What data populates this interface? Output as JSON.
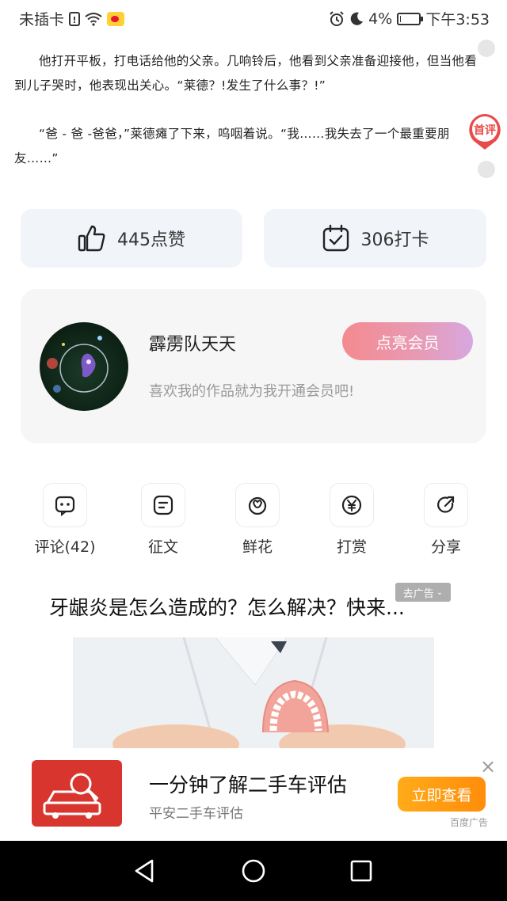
{
  "status_bar": {
    "carrier": "未插卡",
    "sim_glyph": "!",
    "battery": "4%",
    "battery_level": 0.04,
    "time": "下午3:53",
    "icons": [
      "sim-icon",
      "wifi-icon",
      "weibo-icon",
      "alarm-icon",
      "moon-icon",
      "battery-icon"
    ]
  },
  "article": {
    "paragraph1": "他打开平板，打电话给他的父亲。几响铃后，他看到父亲准备迎接他，但当他看到儿子哭时，他表现出关心。“莱德？!发生了什么事？!”",
    "paragraph2": "“爸 - 爸 -爸爸，”莱德瘫了下来，呜咽着说。“我……我失去了一个最重要朋友……”"
  },
  "first_comment_label": "首评",
  "stats": {
    "like_label": "445点赞",
    "checkin_label": "306打卡"
  },
  "author": {
    "name": "霹雳队天天",
    "desc": "喜欢我的作品就为我开通会员吧!",
    "vip_button": "点亮会员"
  },
  "actions": [
    {
      "label": "评论(42)",
      "icon": "comment-icon"
    },
    {
      "label": "征文",
      "icon": "essay-icon"
    },
    {
      "label": "鲜花",
      "icon": "flower-icon"
    },
    {
      "label": "打赏",
      "icon": "reward-icon"
    },
    {
      "label": "分享",
      "icon": "share-icon"
    }
  ],
  "ad": {
    "title": "牙龈炎是怎么造成的？怎么解决？快来...",
    "tag": "去广告"
  },
  "banner": {
    "title": "一分钟了解二手车评估",
    "subtitle": "平安二手车评估",
    "button": "立即查看",
    "close": "×",
    "source": "百度广告"
  },
  "colors": {
    "accent_red": "#e94b4b",
    "vip_gradient_start": "#f48a8f",
    "vip_gradient_end": "#d7a7e0",
    "banner_button": "#ff9a10",
    "pill_bg": "#f1f5f9"
  }
}
